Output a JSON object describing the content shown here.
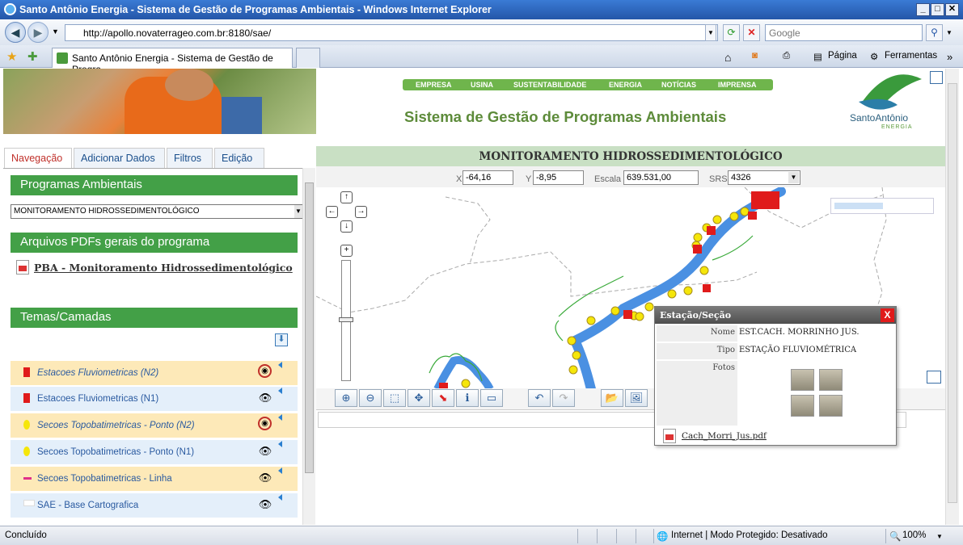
{
  "browser": {
    "title": "Santo Antônio Energia - Sistema de Gestão de Programas Ambientais - Windows Internet Explorer",
    "url": "http://apollo.novaterrageo.com.br:8180/sae/",
    "search_placeholder": "Google",
    "tab_title": "Santo Antônio Energia - Sistema de Gestão de Progra...",
    "commands": {
      "pagina": "Página",
      "ferramentas": "Ferramentas"
    }
  },
  "site": {
    "nav": [
      "EMPRESA",
      "USINA",
      "SUSTENTABILIDADE",
      "ENERGIA",
      "NOTÍCIAS",
      "IMPRENSA"
    ],
    "title": "Sistema de Gestão de Programas Ambientais",
    "logo_name": "SantoAntônio",
    "logo_sub": "ENERGIA"
  },
  "left_panel": {
    "tabs": [
      "Navegação",
      "Adicionar Dados",
      "Filtros",
      "Edição"
    ],
    "programas_header": "Programas Ambientais",
    "programa_selected": "MONITORAMENTO HIDROSSEDIMENTOLÓGICO",
    "arquivos_header": "Arquivos PDFs gerais do programa",
    "pdf_link": "PBA - Monitoramento Hidrossedimentológico",
    "temas_header": "Temas/Camadas",
    "layers": [
      {
        "label": "Estacoes Fluviometricas (N2)",
        "color": "#e01b1b"
      },
      {
        "label": "Estacoes Fluviometricas (N1)",
        "color": "#e01b1b"
      },
      {
        "label": "Secoes Topobatimetricas - Ponto (N2)",
        "color": "#f5e60a"
      },
      {
        "label": "Secoes Topobatimetricas - Ponto (N1)",
        "color": "#f5e60a"
      },
      {
        "label": "Secoes Topobatimetricas - Linha",
        "color": "#e0308a"
      },
      {
        "label": "SAE - Base Cartografica",
        "color": "#ffffff"
      }
    ]
  },
  "map": {
    "header": "MONITORAMENTO HIDROSSEDIMENTOLÓGICO",
    "x_label": "X",
    "x_value": "-64,16",
    "y_label": "Y",
    "y_value": "-8,95",
    "escala_label": "Escala",
    "escala_value": "639.531,00",
    "srs_label": "SRS",
    "srs_value": "4326"
  },
  "popup": {
    "title": "Estação/Seção",
    "close": "X",
    "nome_label": "Nome",
    "nome_value": "EST.CACH. MORRINHO JUS.",
    "tipo_label": "Tipo",
    "tipo_value": "ESTAÇÃO FLUVIOMÉTRICA",
    "fotos_label": "Fotos",
    "pdf": "Cach_Morri_Jus.pdf"
  },
  "status": {
    "left": "Concluído",
    "zone": "Internet | Modo Protegido: Desativado",
    "zoom": "100%"
  }
}
